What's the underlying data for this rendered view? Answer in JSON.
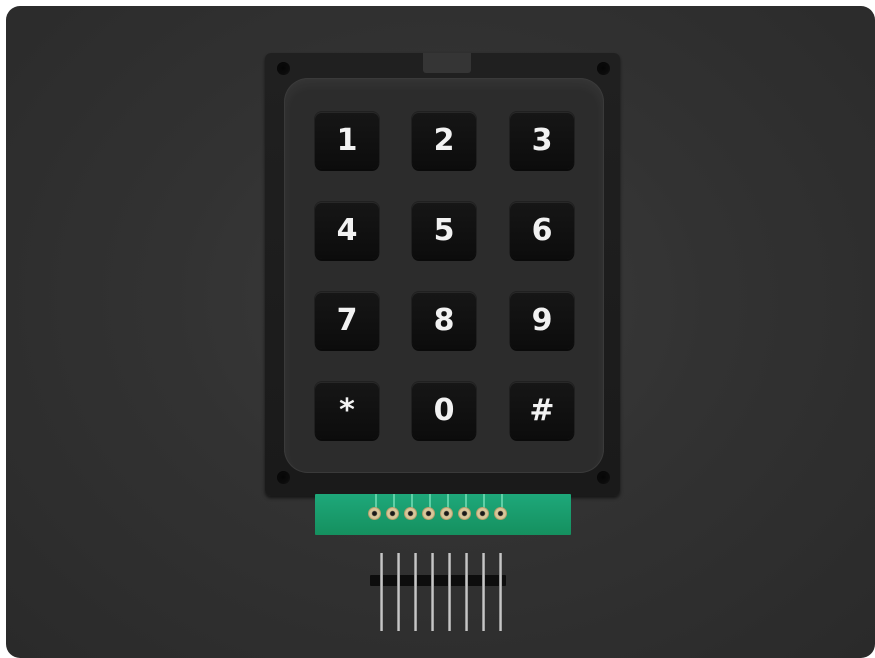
{
  "image": {
    "subject": "keypad",
    "colors": {
      "background": "#323232",
      "keypad_body": "#2c2c2c",
      "key": "#111111",
      "key_text": "#f2f2f2",
      "pcb": "#1ea87a"
    }
  },
  "keypad": {
    "keys": [
      "1",
      "2",
      "3",
      "4",
      "5",
      "6",
      "7",
      "8",
      "9",
      "*",
      "0",
      "#"
    ]
  }
}
